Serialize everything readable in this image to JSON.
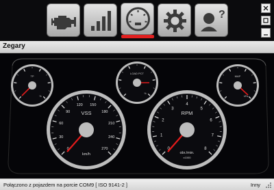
{
  "toolbar": {
    "buttons": [
      {
        "icon": "engine-icon",
        "active": false
      },
      {
        "icon": "signal-bars-icon",
        "active": false
      },
      {
        "icon": "gauge-icon",
        "active": true
      },
      {
        "icon": "gear-icon",
        "active": false
      },
      {
        "icon": "help-user-icon",
        "active": false
      }
    ],
    "accent_color": "#e02020"
  },
  "window_controls": [
    "close-icon",
    "maximize-icon",
    "minimize-icon"
  ],
  "panel": {
    "title": "Zegary"
  },
  "gauges": [
    {
      "id": "tp",
      "label": "TP",
      "unit": "%",
      "value": 0
    },
    {
      "id": "loadpct",
      "label": "LOAD PCT",
      "unit": "%",
      "value": 0
    },
    {
      "id": "map",
      "label": "MAP",
      "unit": "kPa",
      "value": 0
    },
    {
      "id": "vss",
      "label": "VSS",
      "unit": "km/h",
      "value": 0,
      "ticks": [
        "0",
        "30",
        "60",
        "90",
        "120",
        "150",
        "180",
        "210",
        "240",
        "270"
      ]
    },
    {
      "id": "rpm",
      "label": "RPM",
      "unit": "obr./min.",
      "unit2": "x1000",
      "value": 0,
      "ticks": [
        "0",
        "1",
        "2",
        "3",
        "4",
        "5",
        "6",
        "7",
        "8"
      ]
    }
  ],
  "status": {
    "text": "Połączono z pojazdem na porcie COM9  [ ISO 9141-2 ]",
    "right": "Inny"
  }
}
